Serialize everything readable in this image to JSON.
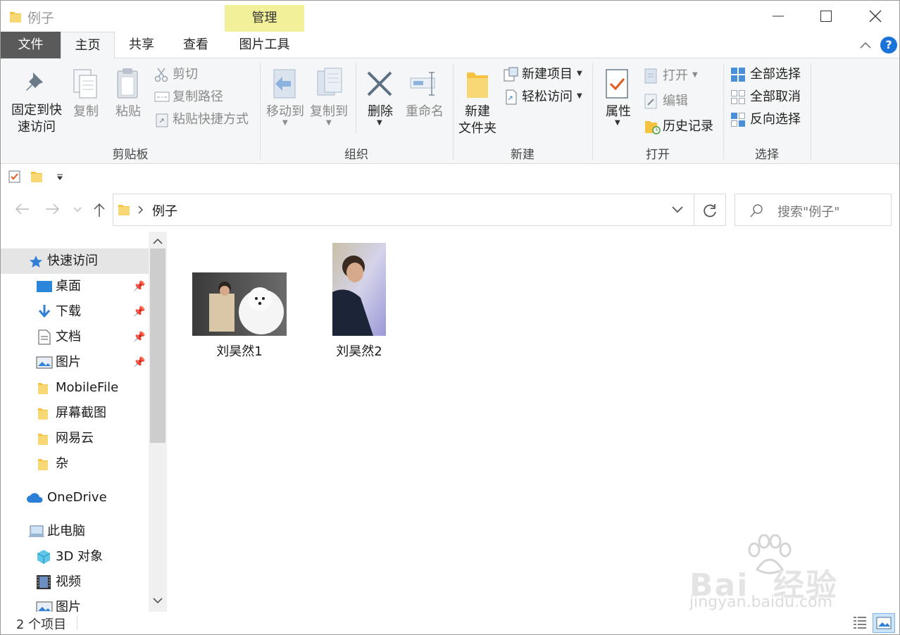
{
  "window": {
    "title": "例子",
    "context_tab": "管理",
    "controls": {
      "minimize": "minimize-icon",
      "maximize": "maximize-icon",
      "close": "close-icon"
    }
  },
  "tabs": [
    "文件",
    "主页",
    "共享",
    "查看",
    "图片工具"
  ],
  "ribbon": {
    "clipboard": {
      "pin_line1": "固定到快",
      "pin_line2": "速访问",
      "copy": "复制",
      "paste": "粘贴",
      "cut": "剪切",
      "copy_path": "复制路径",
      "paste_shortcut": "粘贴快捷方式",
      "label": "剪贴板"
    },
    "organize": {
      "move_to": "移动到",
      "copy_to": "复制到",
      "delete": "删除",
      "rename": "重命名",
      "label": "组织"
    },
    "new": {
      "new_folder_line1": "新建",
      "new_folder_line2": "文件夹",
      "new_item": "新建项目",
      "easy_access": "轻松访问",
      "label": "新建"
    },
    "open": {
      "properties": "属性",
      "open": "打开",
      "edit": "编辑",
      "history": "历史记录",
      "label": "打开"
    },
    "select": {
      "select_all": "全部选择",
      "select_none": "全部取消",
      "invert": "反向选择",
      "label": "选择"
    }
  },
  "address": {
    "path": "例子",
    "search_placeholder": "搜索\"例子\""
  },
  "sidebar": {
    "quick_access": "快速访问",
    "items": [
      "桌面",
      "下载",
      "文档",
      "图片",
      "MobileFile",
      "屏幕截图",
      "网易云",
      "杂"
    ],
    "onedrive": "OneDrive",
    "this_pc": "此电脑",
    "pc_items": [
      "3D 对象",
      "视频",
      "图片"
    ]
  },
  "files": [
    {
      "name": "刘昊然1"
    },
    {
      "name": "刘昊然2"
    }
  ],
  "status": {
    "count": "2 个项目"
  },
  "watermark": {
    "brand": "Bai  经验",
    "url": "jingyan.baidu.com"
  },
  "colors": {
    "accent": "#0078d7",
    "context_tab": "#f3f09a",
    "file_tab": "#5a5a5a",
    "folder": "#f5c242"
  }
}
